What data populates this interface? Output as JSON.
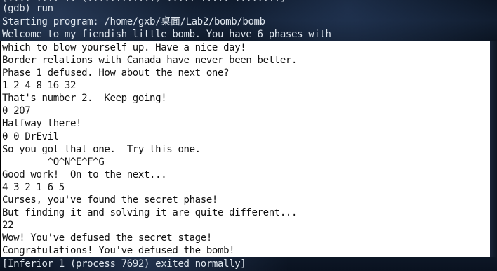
{
  "terminal": {
    "top_partial": "[.... .... .. (............) ..... ..... ........]",
    "lines": [
      "(gdb) run",
      "Starting program: /home/gxb/桌面/Lab2/bomb/bomb",
      "Welcome to my fiendish little bomb. You have 6 phases with",
      "which to blow yourself up. Have a nice day!",
      "Border relations with Canada have never been better.",
      "Phase 1 defused. How about the next one?",
      "1 2 4 8 16 32",
      "That's number 2.  Keep going!",
      "0 207",
      "Halfway there!",
      "0 0 DrEvil",
      "So you got that one.  Try this one.",
      "        ^O^N^E^F^G",
      "Good work!  On to the next...",
      "4 3 2 1 6 5",
      "Curses, you've found the secret phase!",
      "But finding it and solving it are quite different...",
      "22",
      "Wow! You've defused the secret stage!",
      "Congratulations! You've defused the bomb!",
      "[Inferior 1 (process 7692) exited normally]"
    ]
  }
}
